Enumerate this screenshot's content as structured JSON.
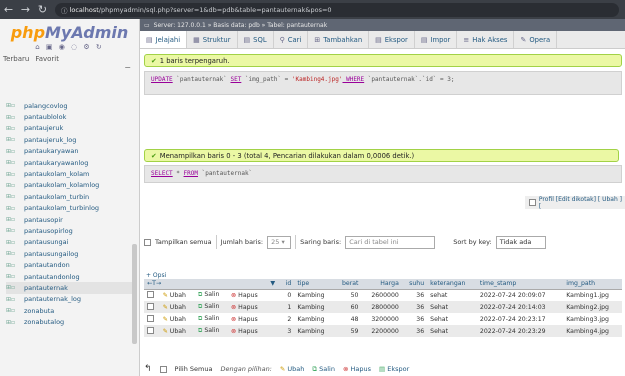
{
  "browser": {
    "url_host": "localhost",
    "url_rest": "/phpmyadmin/sql.php?server=1&db=pdb&table=pantauternak&pos=0"
  },
  "sidebar": {
    "logo_php": "php",
    "logo_my": "MyAdmin",
    "tabs": [
      "Terbaru",
      "Favorit"
    ],
    "items": [
      "palangcovlog",
      "pantaublolok",
      "pantaujeruk",
      "pantaujeruk_log",
      "pantaukaryawan",
      "pantaukaryawanlog",
      "pantaukolam_kolam",
      "pantaukolam_kolamlog",
      "pantaukolam_turbin",
      "pantaukolam_turbinlog",
      "pantausopir",
      "pantausopirlog",
      "pantausungai",
      "pantausungailog",
      "pantautandon",
      "pantautandonlog",
      "pantauternak",
      "pantauternak_log",
      "zonabuta",
      "zonabutalog"
    ],
    "selected": "pantauternak"
  },
  "server_bar": "Server: 127.0.0.1 » Basis data: pdb » Tabel: pantauternak",
  "tabs": [
    {
      "icon": "▤",
      "label": "Jelajahi"
    },
    {
      "icon": "▦",
      "label": "Struktur"
    },
    {
      "icon": "▤",
      "label": "SQL"
    },
    {
      "icon": "⚲",
      "label": "Cari"
    },
    {
      "icon": "⊞",
      "label": "Tambahkan"
    },
    {
      "icon": "▤",
      "label": "Ekspor"
    },
    {
      "icon": "▤",
      "label": "Impor"
    },
    {
      "icon": "≡",
      "label": "Hak Akses"
    },
    {
      "icon": "✎",
      "label": "Opera"
    }
  ],
  "msg1": "1 baris terpengaruh.",
  "sql1": {
    "k1": "UPDATE",
    "t1": " `pantauternak` ",
    "k2": "SET",
    "t2": " `img_path` = ",
    "s1": "'Kambing4.jpg'",
    "k3": " WHERE",
    "t3": " `pantauternak`.`id` = 3;"
  },
  "msg2": "Menampilkan baris 0 - 3 (total 4, Pencarian dilakukan dalam 0,0006 detik.)",
  "sql2": {
    "k1": "SELECT",
    "t1": " * ",
    "k2": "FROM",
    "t2": " `pantauternak`"
  },
  "profil": "Profil [Edit dikotak] [ Ubah ] [",
  "controls": {
    "show_all": "Tampilkan semua",
    "rows_label": "Jumlah baris:",
    "rows_value": "25",
    "filter_label": "Saring baris:",
    "filter_placeholder": "Cari di tabel ini",
    "sort_label": "Sort by key:",
    "sort_value": "Tidak ada"
  },
  "opsi": "+ Opsi",
  "columns": [
    "id",
    "tipe",
    "berat",
    "Harga",
    "suhu",
    "keterangan",
    "time_stamp",
    "img_path"
  ],
  "row_actions": {
    "edit": "Ubah",
    "copy": "Salin",
    "delete": "Hapus"
  },
  "rows": [
    [
      "0",
      "Kambing",
      "50",
      "2600000",
      "36",
      "sehat",
      "2022-07-24 20:09:07",
      "Kambing1.jpg"
    ],
    [
      "1",
      "Kambing",
      "60",
      "2800000",
      "36",
      "Sehat",
      "2022-07-24 20:14:03",
      "Kambing2.jpg"
    ],
    [
      "2",
      "Kambing",
      "48",
      "3200000",
      "36",
      "Sehat",
      "2022-07-24 20:23:17",
      "Kambing3.jpg"
    ],
    [
      "3",
      "Kambing",
      "59",
      "2200000",
      "36",
      "Sehat",
      "2022-07-24 20:23:29",
      "Kambing4.jpg"
    ]
  ],
  "bottom": {
    "check_all": "Pilih Semua",
    "with_selected": "Dengan pilihan:",
    "edit": "Ubah",
    "copy": "Salin",
    "delete": "Hapus",
    "export": "Ekspor"
  }
}
